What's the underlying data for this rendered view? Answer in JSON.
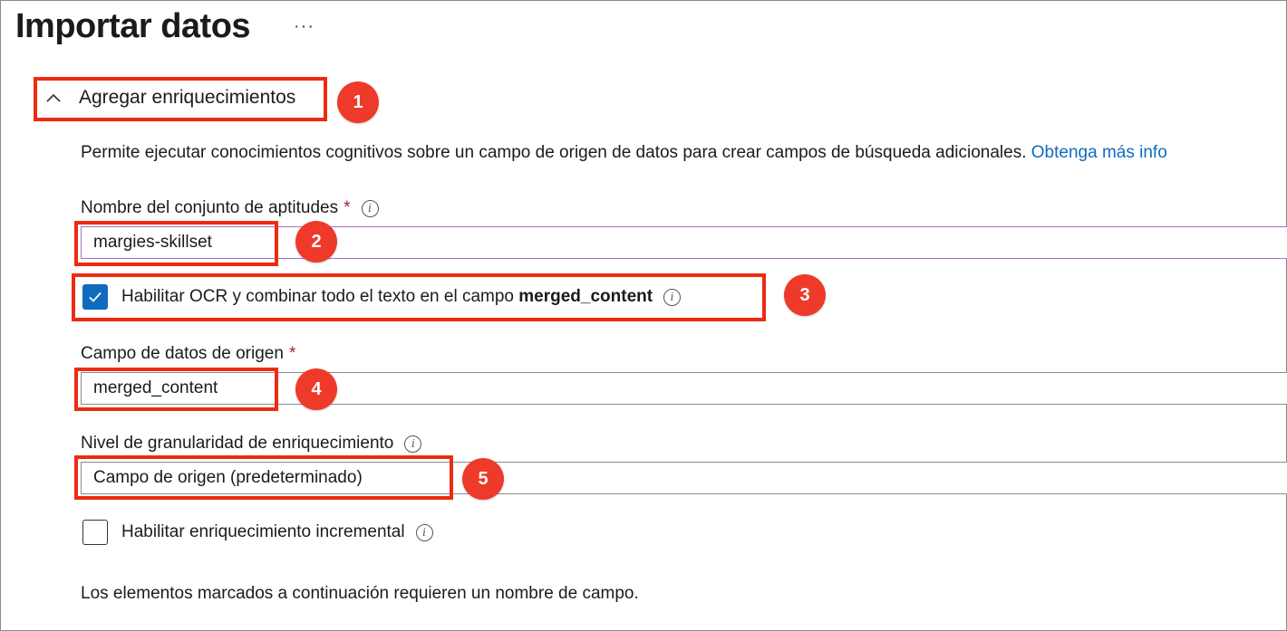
{
  "page": {
    "title": "Importar datos",
    "more_label": "···"
  },
  "section": {
    "label": "Agregar enriquecimientos",
    "description": "Permite ejecutar conocimientos cognitivos sobre un campo de origen de datos para crear campos de búsqueda adicionales.",
    "learn_more": "Obtenga más info"
  },
  "skillset": {
    "label": "Nombre del conjunto de aptitudes",
    "required": "*",
    "value": "margies-skillset"
  },
  "ocr": {
    "checked": true,
    "label_prefix": "Habilitar OCR y combinar todo el texto en el campo ",
    "label_bold": "merged_content"
  },
  "source_field": {
    "label": "Campo de datos de origen",
    "required": "*",
    "value": "merged_content"
  },
  "granularity": {
    "label": "Nivel de granularidad de enriquecimiento",
    "value": "Campo de origen (predeterminado)"
  },
  "incremental": {
    "checked": false,
    "label": "Habilitar enriquecimiento incremental"
  },
  "footer": {
    "text": "Los elementos marcados a continuación requieren un nombre de campo."
  },
  "callouts": [
    "1",
    "2",
    "3",
    "4",
    "5"
  ],
  "colors": {
    "accent": "#0f6cbd",
    "callout": "#ee3a2b",
    "highlight_border": "#ec2b12",
    "required": "#a4262c"
  },
  "icons": {
    "chevron": "chevron-up-icon",
    "info": "info-icon",
    "check": "checkmark-icon"
  }
}
